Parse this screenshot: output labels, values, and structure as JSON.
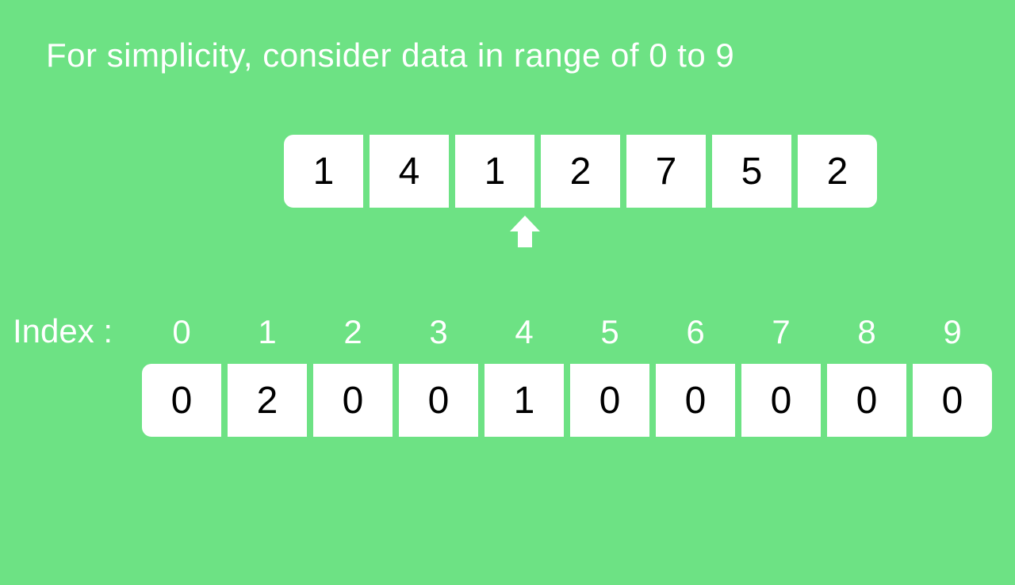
{
  "title": "For simplicity, consider data in range of 0 to 9",
  "dataArray": [
    "1",
    "4",
    "1",
    "2",
    "7",
    "5",
    "2"
  ],
  "indexLabel": "Index :",
  "indices": [
    "0",
    "1",
    "2",
    "3",
    "4",
    "5",
    "6",
    "7",
    "8",
    "9"
  ],
  "countArray": [
    "0",
    "2",
    "0",
    "0",
    "1",
    "0",
    "0",
    "0",
    "0",
    "0"
  ],
  "arrowPointsToDataIndex": 2
}
